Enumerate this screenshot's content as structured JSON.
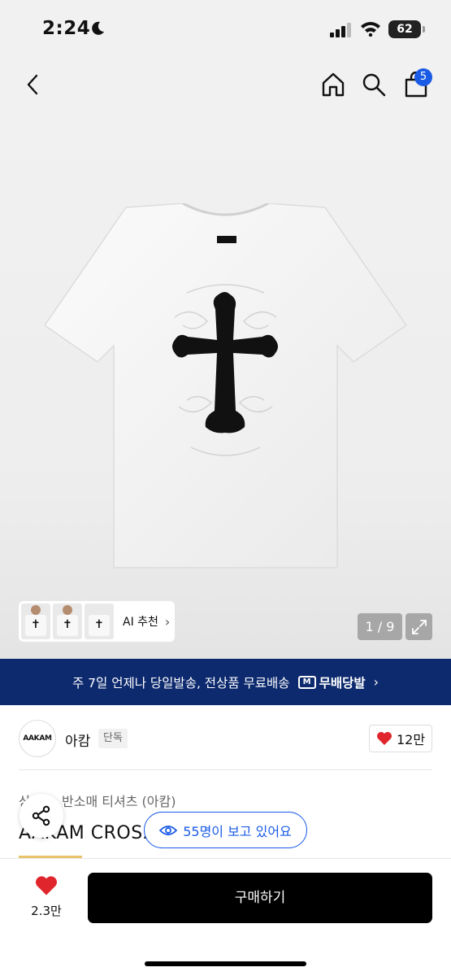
{
  "status_bar": {
    "time": "2:24",
    "battery": "62"
  },
  "header": {
    "cart_count": "5"
  },
  "gallery": {
    "ai_recommend_label": "AI 추천",
    "page_indicator": "1 / 9"
  },
  "shipping_banner": {
    "text": "주 7일 언제나 당일발송, 전상품 무료배송",
    "badge_label": "무배당발"
  },
  "brand": {
    "logo_text": "AAKAM",
    "name": "아캄",
    "tag": "단독",
    "like_count": "12만"
  },
  "product": {
    "category": "상의 > 반소매 티셔츠 (아캄)",
    "title": "AAKAM CROS2 I",
    "viewers_text": "55명이 보고 있어요"
  },
  "bottom_bar": {
    "wish_count": "2.3만",
    "buy_label": "구매하기"
  },
  "colors": {
    "accent_blue": "#1a5be6",
    "banner_navy": "#0d2a6e",
    "heart_red": "#e0262c"
  }
}
